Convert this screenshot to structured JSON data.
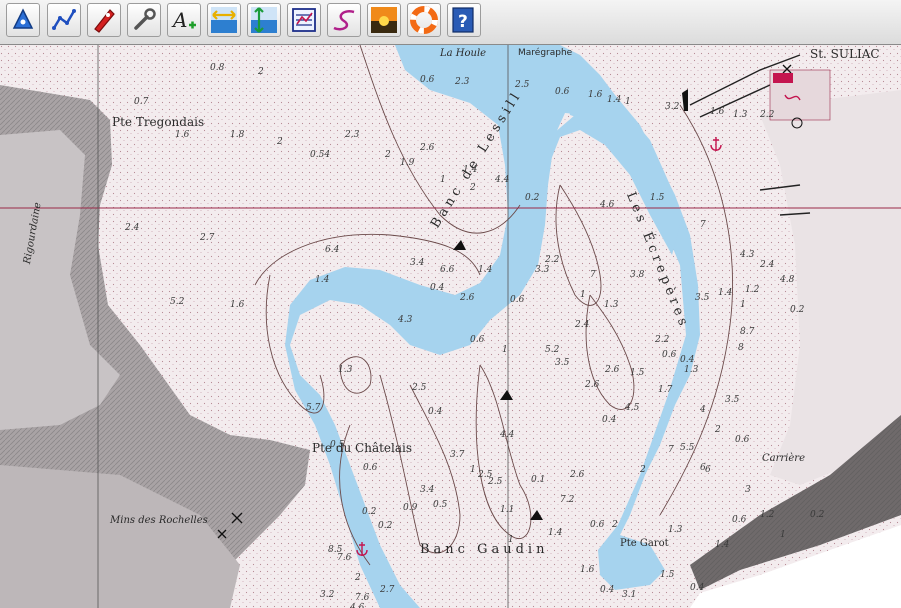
{
  "toolbar": {
    "tools": [
      {
        "name": "waypoint-tool",
        "icon": "waypoint-icon"
      },
      {
        "name": "route-tool",
        "icon": "route-icon"
      },
      {
        "name": "boat-tool",
        "icon": "boat-icon"
      },
      {
        "name": "measure-tool",
        "icon": "wrench-icon"
      },
      {
        "name": "text-annotation-tool",
        "icon": "text-add-icon"
      },
      {
        "name": "zoom-horizontal-tool",
        "icon": "horizontal-arrows-icon"
      },
      {
        "name": "zoom-vertical-tool",
        "icon": "vertical-arrows-icon"
      },
      {
        "name": "chart-list-tool",
        "icon": "chart-list-icon"
      },
      {
        "name": "track-tool",
        "icon": "track-icon"
      },
      {
        "name": "day-night-tool",
        "icon": "sunset-icon"
      },
      {
        "name": "man-overboard-tool",
        "icon": "lifebuoy-icon"
      },
      {
        "name": "help-tool",
        "icon": "help-icon"
      }
    ]
  },
  "chart": {
    "colors": {
      "land": "#f3ecee",
      "cliff": "#9a9496",
      "water": "#a6d3ee",
      "depth_contour": "#6b4a4a",
      "grid": "#9a2848",
      "marker": "#c4154f"
    },
    "labels": {
      "st_suliac": "St. SULIAC",
      "maregraphe": "Marégraphe",
      "la_houle": "La Houle",
      "pte_tregondais": "Pte Tregondais",
      "pte_chatelais": "Pte du Châtelais",
      "pte_garot": "Pte Garot",
      "banc_lessill": "Banc de Lessill",
      "les_ecreperes": "Les Écrepères",
      "banc_gaudin": "Banc Gaudin",
      "moulins": "Mins des Rochelles",
      "rigourdaine": "Rigourdaine",
      "carriere": "Carrière"
    },
    "soundings": [
      "0.6",
      "2.3",
      "2.5",
      "0.6",
      "1.6",
      "1.4",
      "1",
      "3.2",
      "1.6",
      "1.3",
      "2.2",
      "0.7",
      "0.8",
      "2",
      "1.6",
      "1.8",
      "2",
      "0.54",
      "2.3",
      "2",
      "1.9",
      "2.6",
      "1.4",
      "2",
      "1",
      "4.4",
      "0.2",
      "4.6",
      "1.5",
      "2.4",
      "2.7",
      "6.4",
      "3.4",
      "6.6",
      "1.4",
      "3.3",
      "7",
      "3.8",
      "7",
      "4.3",
      "2.4",
      "5.2",
      "1.4",
      "4.3",
      "1.6",
      "2.2",
      "8",
      "2.4",
      "8.7",
      "0.4",
      "2.6",
      "0.6",
      "1",
      "1.3",
      "2.6",
      "1.5",
      "2.2",
      "0.6",
      "0.4",
      "3.5",
      "1.4",
      "1",
      "1.2",
      "6",
      "1.3",
      "0.6",
      "1",
      "3.5",
      "5.5",
      "6",
      "2.5",
      "0.5",
      "0.2",
      "0.9",
      "0.6",
      "0.2",
      "7.2",
      "0.6",
      "2",
      "1.3",
      "8.5",
      "7.6",
      "2",
      "7.6",
      "5.7",
      "0.5",
      "1.3",
      "2.5",
      "0.4",
      "1",
      "2.5",
      "1.1",
      "1",
      "0.1",
      "1.4",
      "1.6",
      "2.6",
      "0.4",
      "2",
      "7",
      "2",
      "0.6",
      "3",
      "1.4",
      "0.6",
      "1.2",
      "1",
      "0.2",
      "0.4",
      "3.1",
      "1.5",
      "0.4",
      "3.2",
      "4.6",
      "2.7",
      "3.4",
      "3.7",
      "4.4",
      "5.2",
      "2.6",
      "4.5",
      "1.7",
      "4",
      "3.5",
      "4.8",
      "0.2"
    ]
  }
}
